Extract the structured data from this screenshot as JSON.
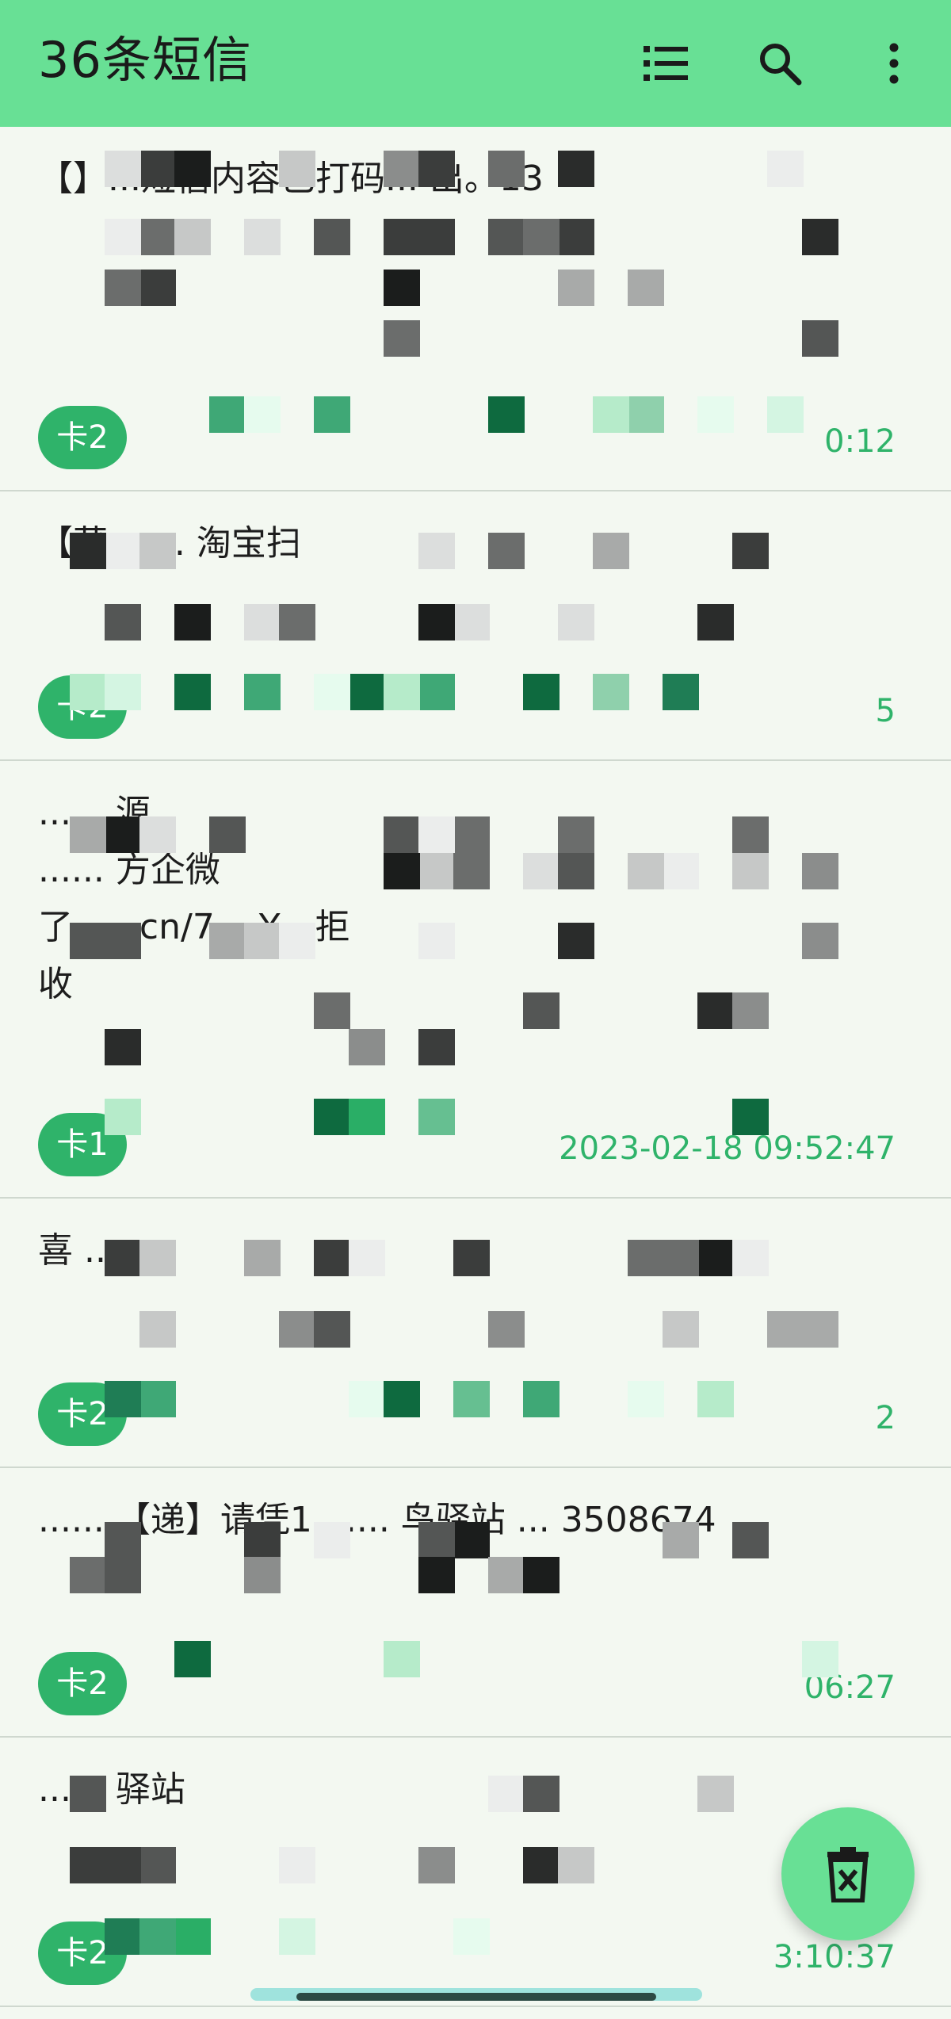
{
  "appbar": {
    "title": "36条短信",
    "actions": [
      {
        "name": "list-icon"
      },
      {
        "name": "search-icon"
      },
      {
        "name": "more-vert-icon"
      }
    ]
  },
  "messages": [
    {
      "body": "【】...短信内容已打码... 出。13",
      "sim": "卡2",
      "time": "0:12"
    },
    {
      "body": "【菜 ...... 淘宝扫",
      "sim": "卡2",
      "time": "5"
    },
    {
      "body": "...... 源\n...... 方企微\n了 ... .cn/7... Y。拒\n收",
      "sim": "卡1",
      "time": "2023-02-18 09:52:47"
    },
    {
      "body": "喜 ......",
      "sim": "卡2",
      "time": "2"
    },
    {
      "body": "...... 【递】请凭1 ...... 鸟驿站 ... 3508674",
      "sim": "卡2",
      "time": "06:27"
    },
    {
      "body": "...... 驿站",
      "sim": "卡2",
      "time": "3:10:37"
    }
  ],
  "colors": {
    "appbar": "#68e095",
    "accent": "#2fb36a",
    "background": "#f3f8f1"
  },
  "fab": {
    "icon": "delete-icon"
  }
}
